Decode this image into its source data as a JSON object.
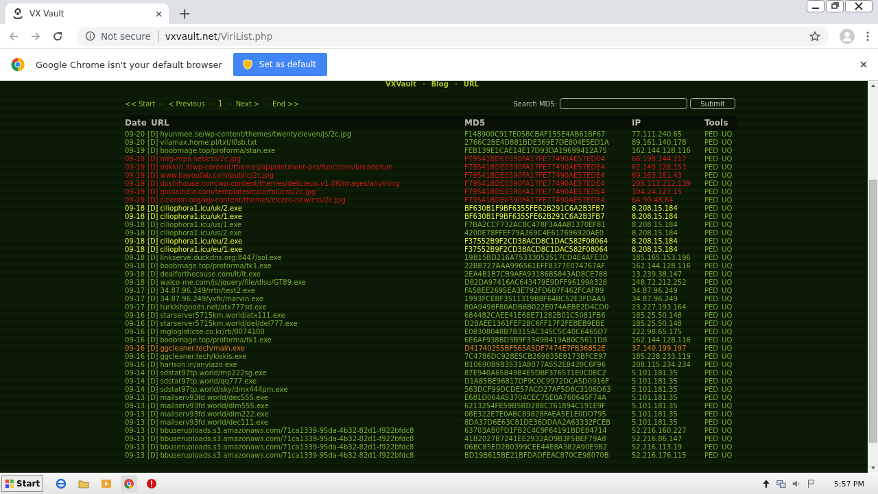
{
  "browser": {
    "tab_title": "VX Vault",
    "new_tab": "+",
    "security": "Not secure",
    "url_domain": "vxvault.net",
    "url_path": "/ViriList.php"
  },
  "infobar": {
    "message": "Google Chrome isn't your default browser",
    "button": "Set as default"
  },
  "nav": [
    {
      "label": "VXVault"
    },
    {
      "label": "Blog"
    },
    {
      "label": "URL"
    }
  ],
  "pagination": [
    {
      "kind": "link",
      "text": "<< Start"
    },
    {
      "kind": "sep",
      "text": "···"
    },
    {
      "kind": "link",
      "text": "< Previous"
    },
    {
      "kind": "sep",
      "text": "···"
    },
    {
      "kind": "page",
      "text": "1"
    },
    {
      "kind": "sep",
      "text": "···"
    },
    {
      "kind": "link",
      "text": "Next >"
    },
    {
      "kind": "sep",
      "text": "···"
    },
    {
      "kind": "link",
      "text": "End >>"
    }
  ],
  "search": {
    "label": "Search MD5:",
    "button": "Submit"
  },
  "table": {
    "columns": [
      "Date",
      "URL",
      "MD5",
      "IP",
      "Tools"
    ],
    "rows": [
      {
        "date": "09-20",
        "d": "[D]",
        "url": "hyunmee.se/wp-content/themes/twentyeleven/js/2c.jpg",
        "md5": "F148900C917E058CBAF155E4AB61BF67",
        "ip": "77.111.240.65",
        "tools": [
          "PED",
          "UQ"
        ],
        "color": "#7aab34"
      },
      {
        "date": "09-20",
        "d": "[D]",
        "url": "vilamax.home.pl/txt/l0sb.txt",
        "md5": "2766C2BE4D881BDE369E7DE804E5ED1A",
        "ip": "89.161.140.178",
        "tools": [
          "PED",
          "UQ"
        ],
        "color": "#7aab34"
      },
      {
        "date": "09-19",
        "d": "[D]",
        "url": "boobmage.top/proforma/stan.exe",
        "md5": "FEB139E1CAE14E17D93DA19699412A75",
        "ip": "162.144.128.116",
        "tools": [
          "PED",
          "UQ"
        ],
        "color": "#7aab34"
      },
      {
        "date": "09-19",
        "d": "[D]",
        "url": "mfg-reps.net/css/2c.jpg",
        "md5": "F79541BDE0390FA17FE77490AE57EDE4",
        "ip": "66.198.244.217",
        "tools": [
          "PED",
          "UQ"
        ],
        "color": "#d01818"
      },
      {
        "date": "09-19",
        "d": "[D]",
        "url": "mikkiri.it/wp-content/themes/appointment-pro/functions/breadcrum",
        "md5": "F79541BDE0390FA17FE77490AE57EDE4",
        "ip": "62.149.128.151",
        "tools": [
          "PED",
          "UQ"
        ],
        "color": "#d01818"
      },
      {
        "date": "09-19",
        "d": "[D]",
        "url": "www.bayoufab.com/public/2c.jpg",
        "md5": "F79541BDE0390FA17FE77490AE57EDE4",
        "ip": "69.163.161.43",
        "tools": [
          "PED",
          "UQ"
        ],
        "color": "#d01818"
      },
      {
        "date": "09-19",
        "d": "[D]",
        "url": "doshihouse.com/wp-content/themes/delicieux-v1-06/images/anything",
        "md5": "F79541BDE0390FA17FE77490AE57EDE4",
        "ip": "208.113.212.139",
        "tools": [
          "PED",
          "UQ"
        ],
        "color": "#d01818"
      },
      {
        "date": "09-19",
        "d": "[D]",
        "url": "guidaindia.com/templates/colorfall/css/2c.jpg",
        "md5": "F79541BDE0390FA17FE77490AE57EDE4",
        "ip": "104.24.127.15",
        "tools": [
          "PED",
          "UQ"
        ],
        "color": "#d01818"
      },
      {
        "date": "09-19",
        "d": "[D]",
        "url": "ciceroin.org/wp-content/themes/cicero-new/css/2c.jpg",
        "md5": "F79541BDE0390FA17FE77490AE57EDE4",
        "ip": "64.90.48.64",
        "tools": [
          "PED",
          "UQ"
        ],
        "color": "#d01818"
      },
      {
        "date": "09-18",
        "d": "[D]",
        "url": "ciliophora1.icu/uk/2.exe",
        "md5": "BF630B1F9BF6355FE62B291C6A2B3FB7",
        "ip": "8.208.15.184",
        "tools": [
          "PED",
          "UQ"
        ],
        "color": "#e8f040"
      },
      {
        "date": "09-18",
        "d": "[D]",
        "url": "ciliophora1.icu/uk/1.exe",
        "md5": "BF630B1F9BF6355FE62B291C6A2B3FB7",
        "ip": "8.208.15.184",
        "tools": [
          "PED",
          "UQ"
        ],
        "color": "#e8f040"
      },
      {
        "date": "09-18",
        "d": "[D]",
        "url": "ciliophora1.icu/us/1.exe",
        "md5": "F7BA2CCF732AC8C478F3A4A81370EF81",
        "ip": "8.208.15.184",
        "tools": [
          "PED",
          "UQ"
        ],
        "color": "#7aab34"
      },
      {
        "date": "09-18",
        "d": "[D]",
        "url": "ciliophora1.icu/us/2.exe",
        "md5": "4200E78FFEF79A269C4E617696920AE0",
        "ip": "8.208.15.184",
        "tools": [
          "PED",
          "UQ"
        ],
        "color": "#7aab34"
      },
      {
        "date": "09-18",
        "d": "[D]",
        "url": "ciliophora1.icu/eu/2.exe",
        "md5": "F37552B9F2CD38ACD8C1DAC582F08064",
        "ip": "8.208.15.184",
        "tools": [
          "PED",
          "UQ"
        ],
        "color": "#e8f040"
      },
      {
        "date": "09-18",
        "d": "[D]",
        "url": "ciliophora1.icu/eu/1.exe",
        "md5": "F37552B9F2CD38ACD8C1DAC582F08064",
        "ip": "8.208.15.184",
        "tools": [
          "PED",
          "UQ"
        ],
        "color": "#e8f040"
      },
      {
        "date": "09-18",
        "d": "[D]",
        "url": "linkserve.duckdns.org:8447/sol.exe",
        "md5": "19B15BD216A75333053517CD4E4AFE3D",
        "ip": "185.165.153.196",
        "tools": [
          "PED",
          "UQ"
        ],
        "color": "#7aab34"
      },
      {
        "date": "09-18",
        "d": "[D]",
        "url": "boobmage.top/proforma/tk1.exe",
        "md5": "22BB727AAA996561EFF8377E074767AF",
        "ip": "162.144.128.116",
        "tools": [
          "PED",
          "UQ"
        ],
        "color": "#7aab34"
      },
      {
        "date": "09-18",
        "d": "[D]",
        "url": "dealforthecause.com/lt/lt.exe",
        "md5": "2EA4B1B7CB9AFA93186B5843AD8CE788",
        "ip": "13.239.38.147",
        "tools": [
          "PED",
          "UQ"
        ],
        "color": "#7aab34"
      },
      {
        "date": "09-18",
        "d": "[D]",
        "url": "walco-me.com/js/jquery/file/dlsu/GT89.exe",
        "md5": "D82DA97416AC643479E9DFF96199A328",
        "ip": "148.72.212.252",
        "tools": [
          "PED",
          "UQ"
        ],
        "color": "#7aab34"
      },
      {
        "date": "09-17",
        "d": "[D]",
        "url": "34.87.96.249/rrtn/test2.exe",
        "md5": "FA58EE2695EA3E792FD6B7F462FCAF89",
        "ip": "34.87.96.249",
        "tools": [
          "PED",
          "UQ"
        ],
        "color": "#7aab34"
      },
      {
        "date": "09-17",
        "d": "[D]",
        "url": "34.87.96.249/yxfk/marvin.exe",
        "md5": "1993FCEBF3511319B8F64BC52E3FDAA5",
        "ip": "34.87.96.249",
        "tools": [
          "PED",
          "UQ"
        ],
        "color": "#7aab34"
      },
      {
        "date": "09-17",
        "d": "[D]",
        "url": "turkishgoods.net/atx777sd.exe",
        "md5": "80A9498F80ADB6B022E074AEBE2D4CD0",
        "ip": "23.227.193.164",
        "tools": [
          "PED",
          "UQ"
        ],
        "color": "#7aab34"
      },
      {
        "date": "09-16",
        "d": "[D]",
        "url": "starserver5715km.world/atx111.exe",
        "md5": "684482CAEE41E68E71282B01C5081FB6",
        "ip": "185.25.50.148",
        "tools": [
          "PED",
          "UQ"
        ],
        "color": "#7aab34"
      },
      {
        "date": "09-16",
        "d": "[D]",
        "url": "starserver5715km.world/del/del777.exe",
        "md5": "D2BAEE1361FEF2BC6FF17F2FEBEB9EBE",
        "ip": "185.25.50.148",
        "tools": [
          "PED",
          "UQ"
        ],
        "color": "#7aab34"
      },
      {
        "date": "09-16",
        "d": "[D]",
        "url": "mglogisticse.co.kr/rb/8074100",
        "md5": "E08308048B7B315AC345C5C40C6465D7",
        "ip": "222.98.65.175",
        "tools": [
          "PED",
          "UQ"
        ],
        "color": "#7aab34"
      },
      {
        "date": "09-16",
        "d": "[D]",
        "url": "boobmage.top/proforma/tk1.exe",
        "md5": "6E6AF938BD3B9F3349B419A80C5611D8",
        "ip": "162.144.128.116",
        "tools": [
          "PED",
          "UQ"
        ],
        "color": "#7aab34"
      },
      {
        "date": "09-16",
        "d": "[D]",
        "url": "ggcleaner.tech/main.exe",
        "md5": "D41740255BF565A5DF7474E7FB36852E",
        "ip": "37.140.199.197",
        "tools": [
          "PED",
          "UQ"
        ],
        "color": "#e07a20"
      },
      {
        "date": "09-16",
        "d": "[D]",
        "url": "ggcleaner.tech/kiskis.exe",
        "md5": "7C4786DC928E5CB269835E8173BFCE97",
        "ip": "185.228.233.119",
        "tools": [
          "PED",
          "UQ"
        ],
        "color": "#7aab34"
      },
      {
        "date": "09-16",
        "d": "[D]",
        "url": "harison.in/anyiazo.exe",
        "md5": "B10690B9B3531A8077A552E8420C6F96",
        "ip": "208.115.234.234",
        "tools": [
          "PED",
          "UQ"
        ],
        "color": "#7aab34"
      },
      {
        "date": "09-14",
        "d": "[D]",
        "url": "sdstat97tp.world/mp222sg.exe",
        "md5": "87E940A65B4984E5DBF376571E0C0EC2",
        "ip": "5.101.181.35",
        "tools": [
          "PED",
          "UQ"
        ],
        "color": "#7aab34"
      },
      {
        "date": "09-14",
        "d": "[D]",
        "url": "sdstat97tp.world/qq777.exe",
        "md5": "D1A85BE96817DF9C0C9972DCA5D0916F",
        "ip": "5.101.181.35",
        "tools": [
          "PED",
          "UQ"
        ],
        "color": "#7aab34"
      },
      {
        "date": "09-14",
        "d": "[D]",
        "url": "sdstat97tp.world/sky/dmx444pm.exe",
        "md5": "563DCF99DCDE57ACD27AF5D8C3106D63",
        "ip": "5.101.181.35",
        "tools": [
          "PED",
          "UQ"
        ],
        "color": "#7aab34"
      },
      {
        "date": "09-13",
        "d": "[D]",
        "url": "mailserv93fd.world/dec555.exe",
        "md5": "E681D064A53704CEC75E0A760645F74A",
        "ip": "5.101.181.35",
        "tools": [
          "PED",
          "UQ"
        ],
        "color": "#7aab34"
      },
      {
        "date": "09-13",
        "d": "[D]",
        "url": "mailserv93fd.world/dim555.exe",
        "md5": "6213254FE59B5BD288C761894C191E9F",
        "ip": "5.101.181.35",
        "tools": [
          "PED",
          "UQ"
        ],
        "color": "#7aab34"
      },
      {
        "date": "09-13",
        "d": "[D]",
        "url": "mailserv93fd.world/dim222.exe",
        "md5": "08E322E7E0ABC89828FAEA5E1E0DD795",
        "ip": "5.101.181.35",
        "tools": [
          "PED",
          "UQ"
        ],
        "color": "#7aab34"
      },
      {
        "date": "09-13",
        "d": "[D]",
        "url": "mailserv93fd.world/dec111.exe",
        "md5": "8DA37D6E63C81DE36DDAA2A63332FCEB",
        "ip": "5.101.181.35",
        "tools": [
          "PED",
          "UQ"
        ],
        "color": "#7aab34"
      },
      {
        "date": "09-13",
        "d": "[D]",
        "url": "bbuseruploads.s3.amazonaws.com/71ca1339-95da-4b32-82d1-f922bfdc8",
        "md5": "63703AB0FD1FB2C4C9F64191BDE84714",
        "ip": "52.216.160.227",
        "tools": [
          "PED",
          "UQ"
        ],
        "color": "#7aab34"
      },
      {
        "date": "09-13",
        "d": "[D]",
        "url": "bbuseruploads.s3.amazonaws.com/71ca1339-95da-4b32-82d1-f922bfdc8",
        "md5": "41B2027B7241EE2932AD9B3F5BEF79A8",
        "ip": "52.216.86.147",
        "tools": [
          "PED",
          "UQ"
        ],
        "color": "#7aab34"
      },
      {
        "date": "09-13",
        "d": "[D]",
        "url": "bbuseruploads.s3.amazonaws.com/71ca1339-95da-4b32-82d1-f922bfdc8",
        "md5": "06BC85ED2B0399CEE44E8A382A90E9B2",
        "ip": "52.216.113.19",
        "tools": [
          "PED",
          "UQ"
        ],
        "color": "#7aab34"
      },
      {
        "date": "09-13",
        "d": "[D]",
        "url": "bbuseruploads.s3.amazonaws.com/71ca1339-95da-4b32-82d1-f922bfdc8",
        "md5": "BD19B615BE21BFDADFEAC870CE98070B",
        "ip": "52.216.176.115",
        "tools": [
          "PED",
          "UQ"
        ],
        "color": "#7aab34"
      }
    ]
  },
  "taskbar": {
    "start": "Start",
    "clock": "5:57 PM"
  }
}
